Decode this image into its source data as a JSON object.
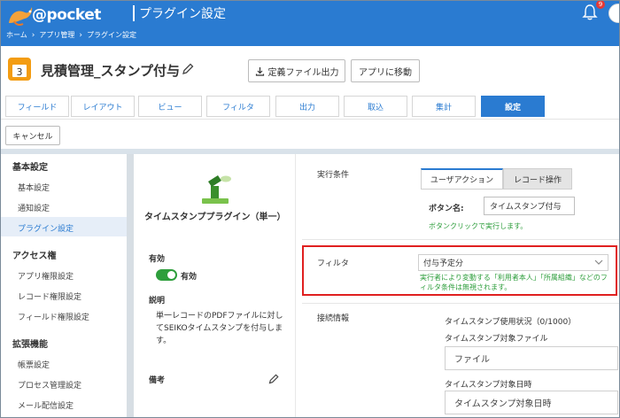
{
  "header": {
    "brand": "@pocket",
    "title": "プラグイン設定",
    "breadcrumb": [
      "ホーム",
      "アプリ管理",
      "プラグイン設定"
    ],
    "notification_count": "9"
  },
  "app": {
    "icon_day": "3",
    "name": "見積管理_スタンプ付与",
    "export_button": "定義ファイル出力",
    "move_button": "アプリに移動"
  },
  "tabs": [
    "フィールド",
    "レイアウト",
    "ビュー",
    "フィルタ",
    "出力",
    "取込",
    "集計",
    "設定"
  ],
  "active_tab": "設定",
  "cancel_button": "キャンセル",
  "sidebar": {
    "sections": [
      {
        "title": "基本設定",
        "items": [
          "基本設定",
          "通知設定",
          "プラグイン設定"
        ]
      },
      {
        "title": "アクセス権",
        "items": [
          "アプリ権限設定",
          "レコード権限設定",
          "フィールド権限設定"
        ]
      },
      {
        "title": "拡張機能",
        "items": [
          "帳票設定",
          "プロセス管理設定",
          "メール配信設定"
        ]
      }
    ],
    "active_item": "プラグイン設定"
  },
  "plugin": {
    "name": "タイムスタンププラグイン（単一）",
    "enabled_label": "有効",
    "toggle_label": "有効",
    "toggle_on": true,
    "description_label": "説明",
    "description": "単一レコードのPDFファイルに対してSEIKOタイムスタンプを付与します。",
    "note_label": "備考"
  },
  "settings": {
    "condition_label": "実行条件",
    "condition_tabs": [
      "ユーザアクション",
      "レコード操作"
    ],
    "button_name_label": "ボタン名:",
    "button_name_value": "タイムスタンプ付与",
    "button_hint": "ボタンクリックで実行します。",
    "filter_label": "フィルタ",
    "filter_value": "付与予定分",
    "filter_hint": "実行者により変動する「利用者本人」「所属組織」などのフィルタ条件は無視されます。",
    "connection_label": "接続情報",
    "usage_label": "タイムスタンプ使用状況（0/1000）",
    "target_file_label": "タイムスタンプ対象ファイル",
    "target_file_value": "ファイル",
    "target_date_label": "タイムスタンプ対象日時",
    "target_date_value": "タイムスタンプ対象日時"
  },
  "colors": {
    "header_blue": "#2a7bd1",
    "active_green": "#2e9e3c",
    "highlight_red": "#e02020"
  }
}
